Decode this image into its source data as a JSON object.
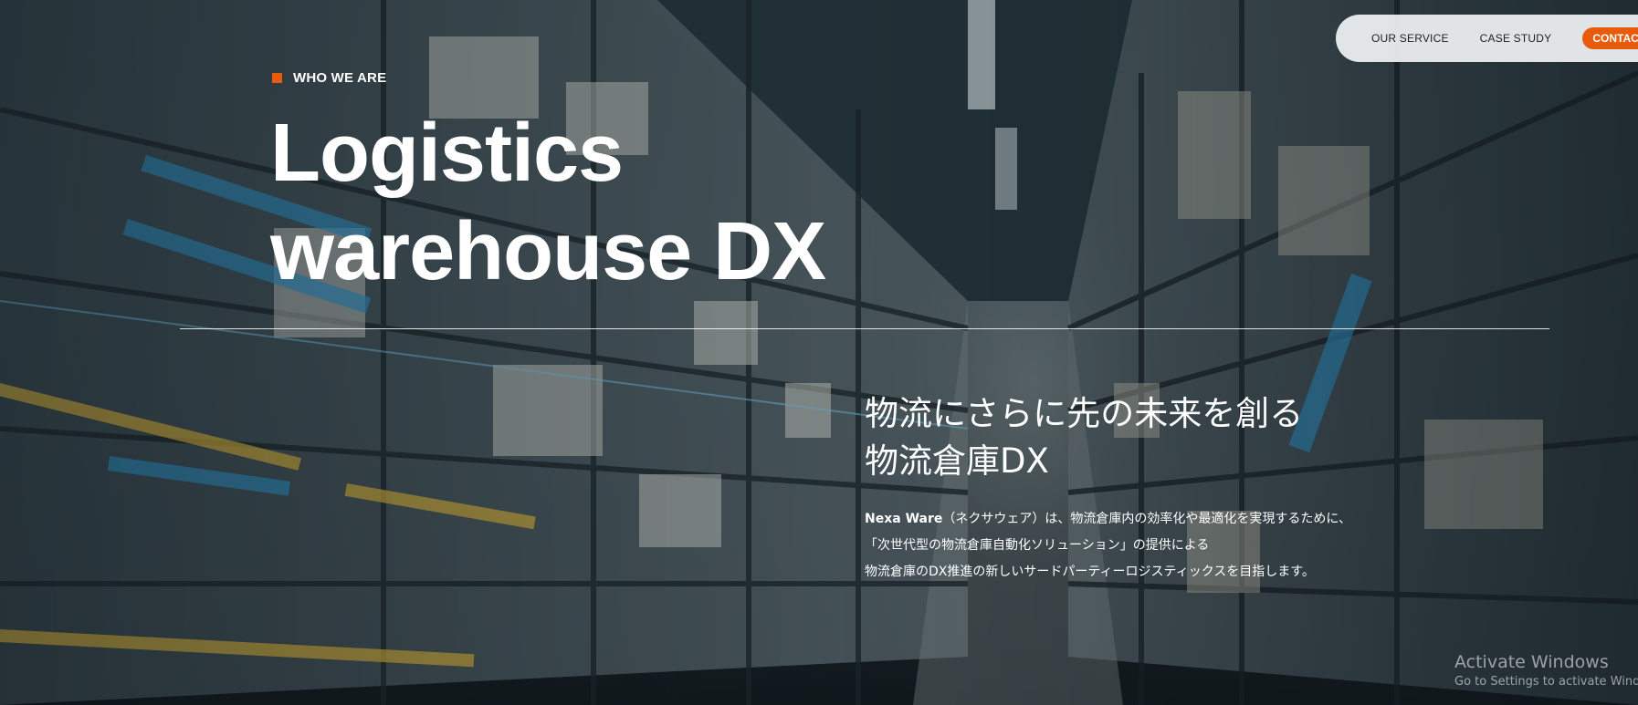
{
  "nav": {
    "items": [
      {
        "label": "OUR SERVICE"
      },
      {
        "label": "CASE STUDY"
      }
    ],
    "contact_label": "CONTACT"
  },
  "hero": {
    "eyebrow": "WHO WE ARE",
    "title_line_1": "Logistics",
    "title_line_2": "warehouse DX"
  },
  "intro": {
    "heading_line_1": "物流にさらに先の未来を創る",
    "heading_line_2": "物流倉庫DX",
    "brand_name": "Nexa Ware",
    "body_line_1_rest": "（ネクサウェア）は、物流倉庫内の効率化や最適化を実現するために、",
    "body_line_2": "「次世代型の物流倉庫自動化ソリューション」の提供による",
    "body_line_3": "物流倉庫のDX推進の新しいサードパーティーロジスティックスを目指します。"
  },
  "watermark": {
    "title": "Activate Windows",
    "subtitle": "Go to Settings to activate Windows."
  },
  "colors": {
    "accent": "#e85a0c",
    "nav_bg": "#ebeef0",
    "text": "#ffffff"
  }
}
